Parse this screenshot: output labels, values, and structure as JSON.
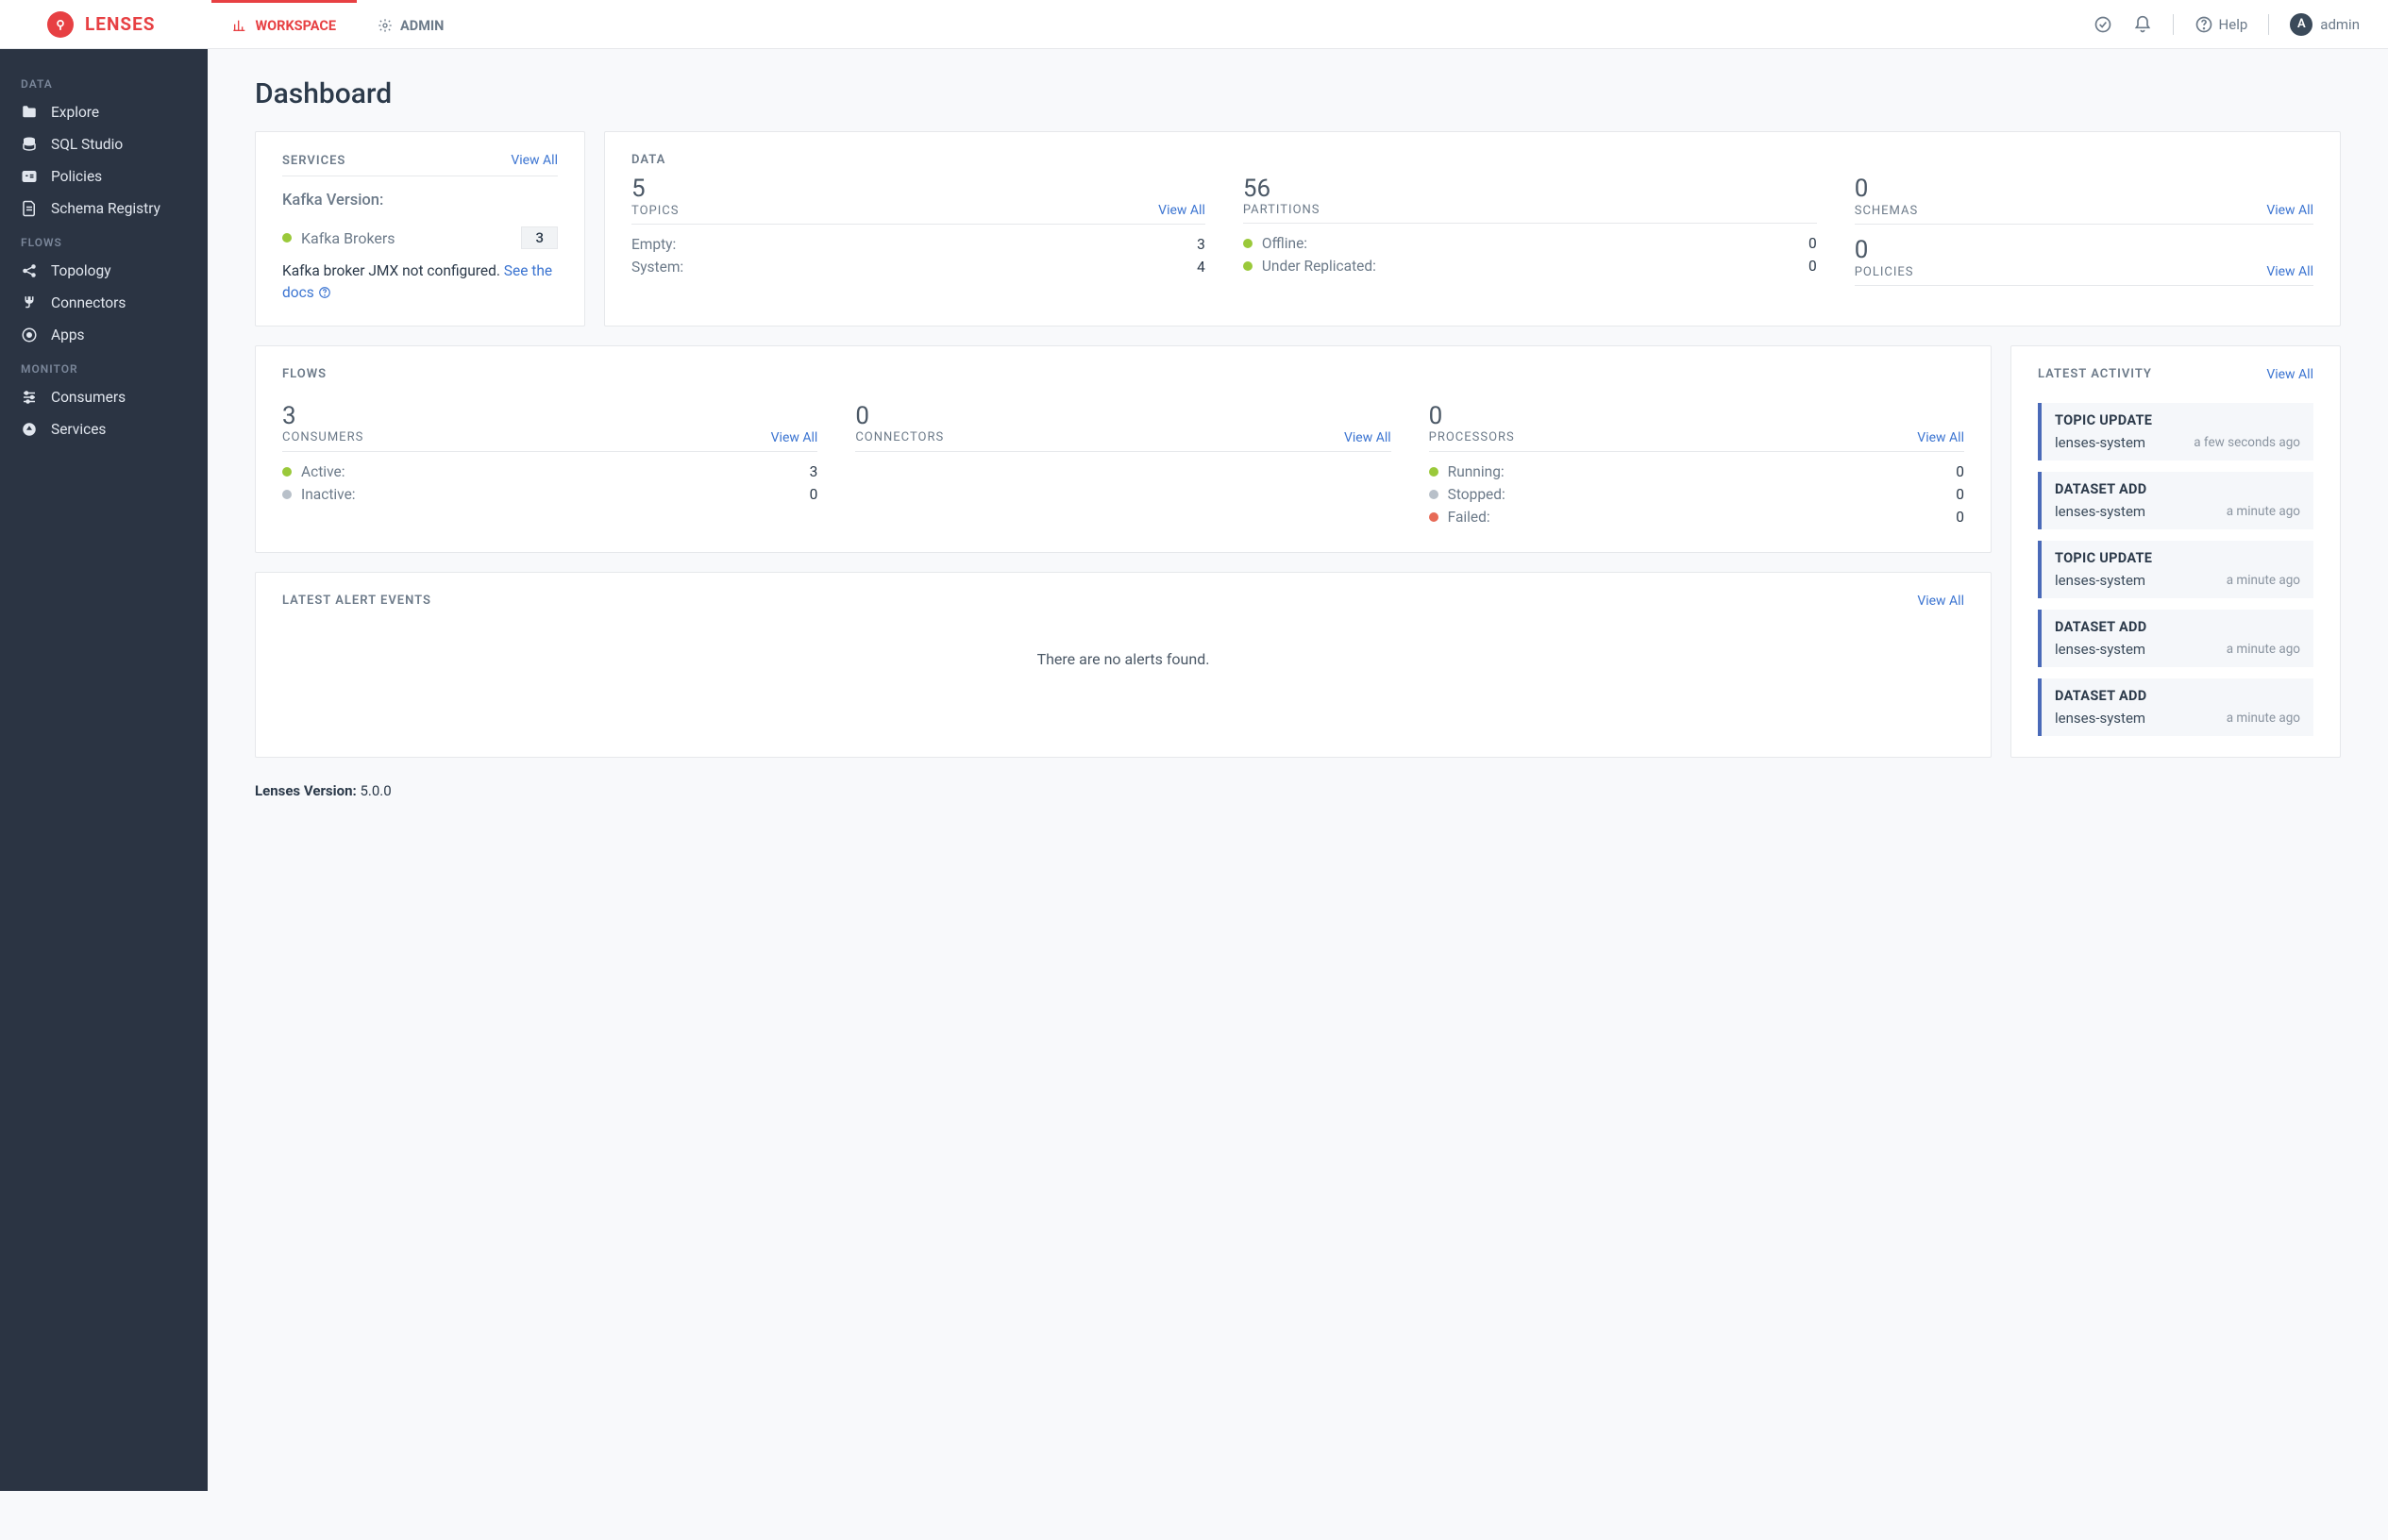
{
  "brand": "LENSES",
  "topnav": {
    "tabs": [
      {
        "label": "WORKSPACE",
        "active": true
      },
      {
        "label": "ADMIN",
        "active": false
      }
    ],
    "help": "Help",
    "user_initial": "A",
    "user_name": "admin"
  },
  "sidebar": {
    "sections": [
      {
        "label": "DATA",
        "items": [
          {
            "icon": "folder-icon",
            "label": "Explore"
          },
          {
            "icon": "database-icon",
            "label": "SQL Studio"
          },
          {
            "icon": "id-card-icon",
            "label": "Policies"
          },
          {
            "icon": "file-icon",
            "label": "Schema Registry"
          }
        ]
      },
      {
        "label": "FLOWS",
        "items": [
          {
            "icon": "share-icon",
            "label": "Topology"
          },
          {
            "icon": "plug-icon",
            "label": "Connectors"
          },
          {
            "icon": "circle-dot-icon",
            "label": "Apps"
          }
        ]
      },
      {
        "label": "MONITOR",
        "items": [
          {
            "icon": "sliders-icon",
            "label": "Consumers"
          },
          {
            "icon": "gauge-icon",
            "label": "Services"
          }
        ]
      }
    ]
  },
  "page": {
    "title": "Dashboard",
    "view_all": "View All",
    "version_label": "Lenses Version:",
    "version_value": "5.0.0"
  },
  "services": {
    "label": "SERVICES",
    "kafka_version_label": "Kafka Version:",
    "brokers_label": "Kafka Brokers",
    "brokers_count": "3",
    "jmx_prefix": "Kafka broker JMX not configured. ",
    "jmx_link": "See the docs"
  },
  "data": {
    "label": "DATA",
    "topics": {
      "value": "5",
      "label": "TOPICS",
      "empty_label": "Empty:",
      "empty_value": "3",
      "system_label": "System:",
      "system_value": "4"
    },
    "partitions": {
      "value": "56",
      "label": "PARTITIONS",
      "offline_label": "Offline:",
      "offline_value": "0",
      "under_rep_label": "Under Replicated:",
      "under_rep_value": "0"
    },
    "schemas": {
      "value": "0",
      "label": "SCHEMAS"
    },
    "policies": {
      "value": "0",
      "label": "POLICIES"
    }
  },
  "flows": {
    "label": "FLOWS",
    "consumers": {
      "value": "3",
      "label": "CONSUMERS",
      "active_label": "Active:",
      "active_value": "3",
      "inactive_label": "Inactive:",
      "inactive_value": "0"
    },
    "connectors": {
      "value": "0",
      "label": "CONNECTORS"
    },
    "processors": {
      "value": "0",
      "label": "PROCESSORS",
      "running_label": "Running:",
      "running_value": "0",
      "stopped_label": "Stopped:",
      "stopped_value": "0",
      "failed_label": "Failed:",
      "failed_value": "0"
    }
  },
  "activity": {
    "label": "LATEST ACTIVITY",
    "items": [
      {
        "title": "TOPIC UPDATE",
        "name": "lenses-system",
        "time": "a few seconds ago"
      },
      {
        "title": "DATASET ADD",
        "name": "lenses-system",
        "time": "a minute ago"
      },
      {
        "title": "TOPIC UPDATE",
        "name": "lenses-system",
        "time": "a minute ago"
      },
      {
        "title": "DATASET ADD",
        "name": "lenses-system",
        "time": "a minute ago"
      },
      {
        "title": "DATASET ADD",
        "name": "lenses-system",
        "time": "a minute ago"
      }
    ]
  },
  "alerts": {
    "label": "LATEST ALERT EVENTS",
    "empty": "There are no alerts found."
  }
}
